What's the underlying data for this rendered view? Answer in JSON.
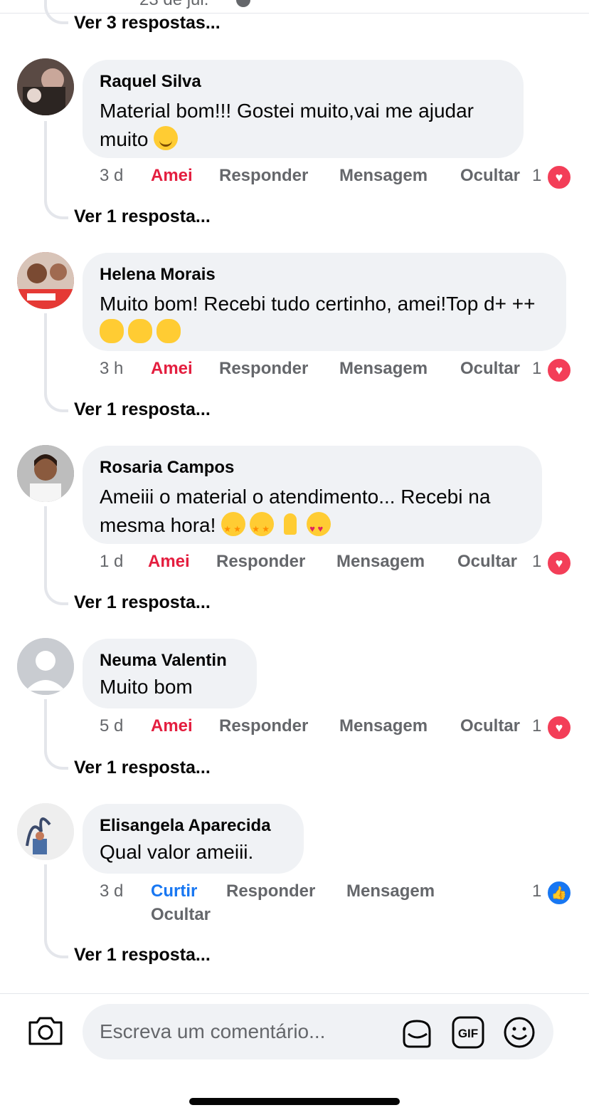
{
  "top": {
    "timestamp_partial": "23 de jul.",
    "view_replies": "Ver 3 respostas..."
  },
  "comments": [
    {
      "author": "Raquel Silva",
      "text": "Material bom!!! Gostei muito,vai me ajudar muito",
      "emojis": [
        "smiling-face"
      ],
      "time": "3 d",
      "reaction_label": "Amei",
      "reply_label": "Responder",
      "message_label": "Mensagem",
      "hide_label": "Ocultar",
      "reaction_count": "1",
      "reaction_type": "love",
      "view_replies": "Ver 1 resposta..."
    },
    {
      "author": "Helena Morais",
      "text": "Muito bom! Recebi tudo certinho, amei!Top d+ ++",
      "emojis": [
        "hugging-face",
        "hugging-face",
        "hugging-face"
      ],
      "time": "3 h",
      "reaction_label": "Amei",
      "reply_label": "Responder",
      "message_label": "Mensagem",
      "hide_label": "Ocultar",
      "reaction_count": "1",
      "reaction_type": "love",
      "view_replies": "Ver 1 resposta..."
    },
    {
      "author": "Rosaria Campos",
      "text": "Ameiii o material o atendimento... Recebi na mesma hora!",
      "emojis": [
        "star-struck",
        "star-struck",
        "folded-hands",
        "heart-eyes"
      ],
      "time": "1 d",
      "reaction_label": "Amei",
      "reply_label": "Responder",
      "message_label": "Mensagem",
      "hide_label": "Ocultar",
      "reaction_count": "1",
      "reaction_type": "love",
      "view_replies": "Ver 1 resposta..."
    },
    {
      "author": "Neuma Valentin",
      "text": "Muito bom",
      "emojis": [],
      "time": "5 d",
      "reaction_label": "Amei",
      "reply_label": "Responder",
      "message_label": "Mensagem",
      "hide_label": "Ocultar",
      "reaction_count": "1",
      "reaction_type": "love",
      "view_replies": "Ver 1 resposta..."
    },
    {
      "author": "Elisangela Aparecida",
      "text": "Qual valor ameiii.",
      "emojis": [],
      "time": "3 d",
      "reaction_label": "Curtir",
      "reply_label": "Responder",
      "message_label": "Mensagem",
      "hide_label": "Ocultar",
      "reaction_count": "1",
      "reaction_type": "like",
      "view_replies": "Ver 1 resposta..."
    }
  ],
  "composer": {
    "placeholder": "Escreva um comentário...",
    "icons": [
      "camera-icon",
      "sticker-icon",
      "gif-icon",
      "emoji-icon"
    ],
    "gif_label": "GIF"
  },
  "colors": {
    "love": "#e41e3f",
    "like": "#1877f2",
    "bubble": "#f0f2f5",
    "muted": "#65676b"
  }
}
